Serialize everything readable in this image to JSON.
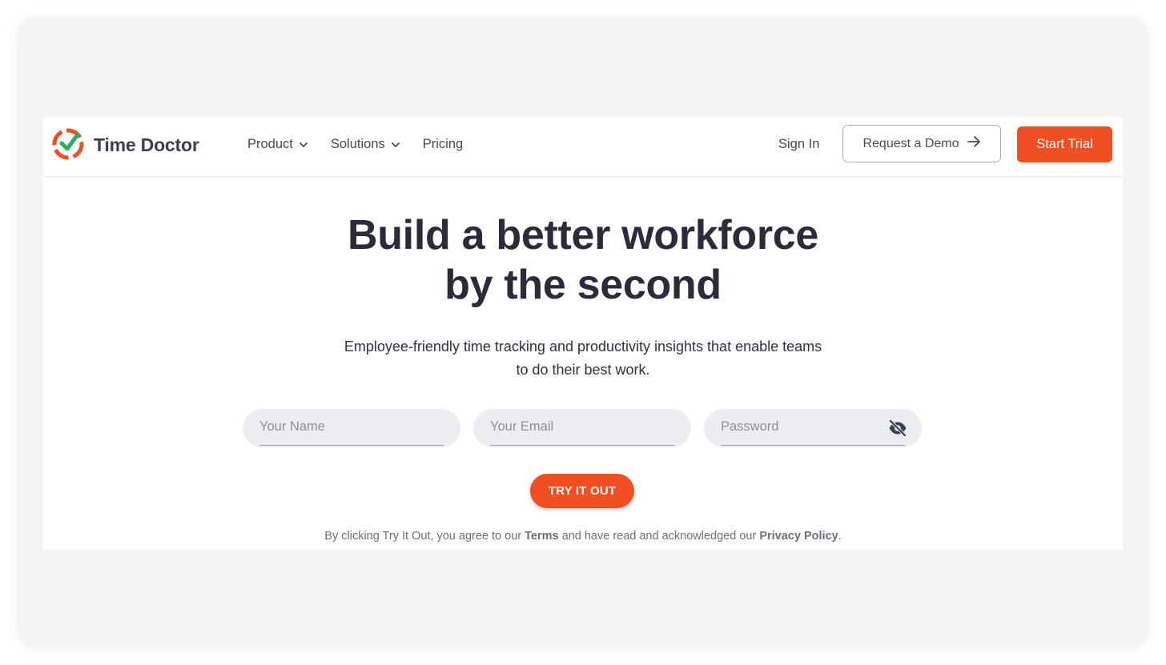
{
  "brand": {
    "name": "Time Doctor",
    "accent_color": "#f04e23",
    "check_color": "#26b35a"
  },
  "nav": {
    "items": [
      {
        "label": "Product",
        "icon": "chevron-down-icon"
      },
      {
        "label": "Solutions",
        "icon": "chevron-down-icon"
      },
      {
        "label": "Pricing"
      }
    ],
    "sign_in": "Sign In",
    "request_demo": "Request a Demo",
    "request_demo_icon": "arrow-right-icon",
    "start_trial": "Start Trial"
  },
  "hero": {
    "title_line1": "Build a better workforce",
    "title_line2": "by the second",
    "subtitle": "Employee-friendly time tracking and productivity insights that enable teams to do their best work."
  },
  "form": {
    "name_placeholder": "Your Name",
    "email_placeholder": "Your Email",
    "password_placeholder": "Password",
    "password_icon": "eye-off-icon",
    "submit": "TRY IT OUT"
  },
  "legal": {
    "prefix": "By clicking Try It Out, you agree to our",
    "terms": "Terms",
    "middle": "and have read and acknowledged our",
    "privacy": "Privacy Policy",
    "suffix": "."
  }
}
